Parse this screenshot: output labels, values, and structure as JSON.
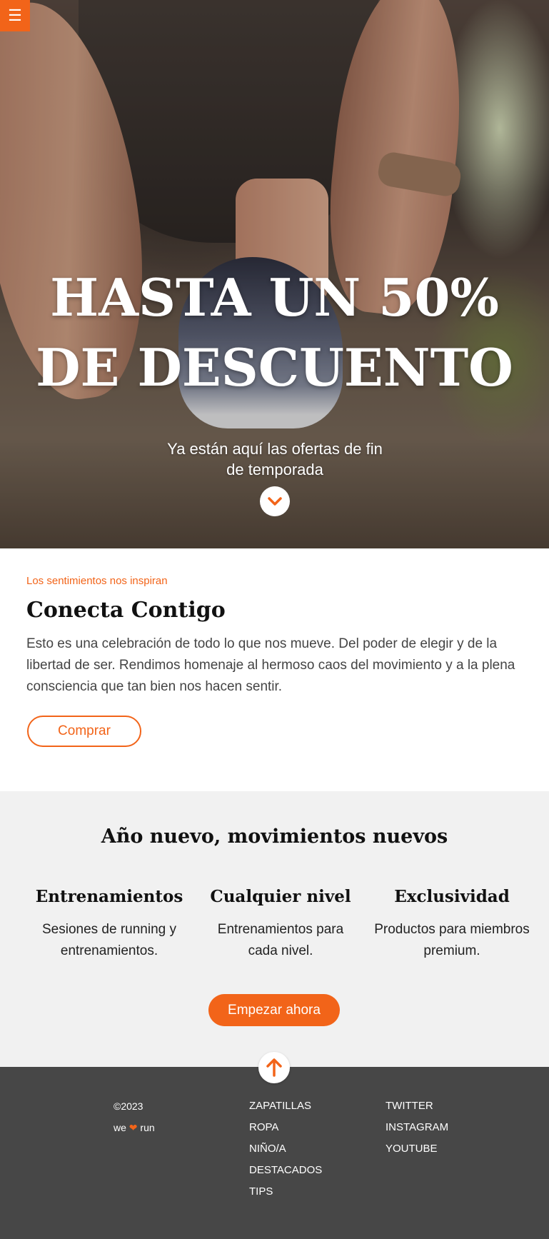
{
  "menu": {
    "icon": "hamburger-icon",
    "glyph": "☰"
  },
  "hero": {
    "title": "HASTA UN 50% DE DESCUENTO",
    "subtitle": "Ya están aquí las ofertas de fin de temporada",
    "scroll_icon": "chevron-down-icon"
  },
  "intro": {
    "eyebrow": "Los sentimientos nos inspiran",
    "title": "Conecta Contigo",
    "text": "Esto es una celebración de todo lo que nos mueve. Del poder de elegir y de la libertad de ser. Rendimos homenaje al hermoso caos del movimiento y a la plena consciencia que tan bien nos hacen sentir.",
    "button": "Comprar"
  },
  "features": {
    "title": "Año nuevo, movimientos nuevos",
    "items": [
      {
        "title": "Entrenamientos",
        "text": "Sesiones de running y entrenamientos."
      },
      {
        "title": "Cualquier nivel",
        "text": "Entrenamientos para cada nivel."
      },
      {
        "title": "Exclusividad",
        "text": "Productos para miembros premium."
      }
    ],
    "button": "Empezar ahora"
  },
  "footer": {
    "copyright": "©2023",
    "tagline_pre": "we",
    "tagline_heart": "❤",
    "tagline_post": "run",
    "nav": [
      "ZAPATILLAS",
      "ROPA",
      "NIÑO/A",
      "DESTACADOS",
      "TIPS"
    ],
    "social": [
      "TWITTER",
      "INSTAGRAM",
      "YOUTUBE"
    ],
    "up_icon": "arrow-up-icon"
  },
  "colors": {
    "accent": "#f26419",
    "footer_bg": "#474747",
    "features_bg": "#f1f1f1"
  }
}
